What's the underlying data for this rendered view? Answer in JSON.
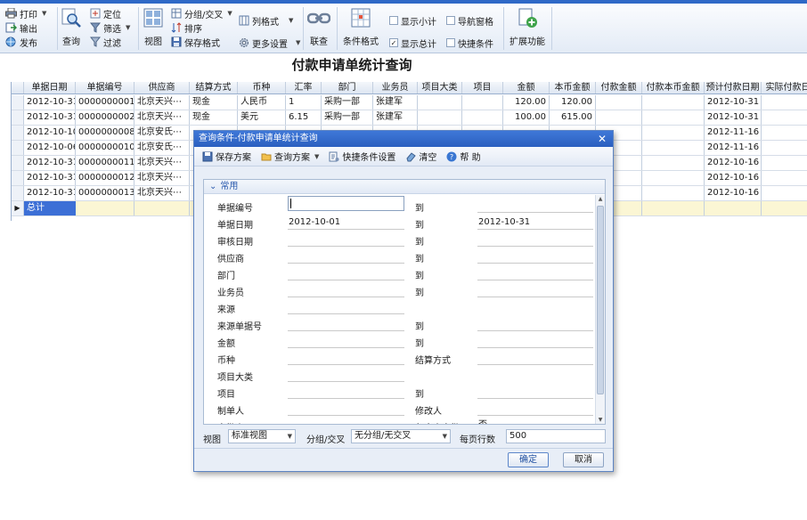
{
  "toolbar": {
    "print": "打印",
    "export": "输出",
    "publish": "发布",
    "query": "查询",
    "locate": "定位",
    "sift": "筛选",
    "filter": "过滤",
    "view": "视图",
    "group_cross": "分组/交叉",
    "sort": "排序",
    "save_format": "保存格式",
    "column_format": "列格式",
    "more_settings": "更多设置",
    "join_query": "联查",
    "condition_format": "条件格式",
    "show_subtotal": "显示小计",
    "show_total": "显示总计",
    "nav_pane": "导航窗格",
    "quick_condition": "快捷条件",
    "extend": "扩展功能"
  },
  "report_title": "付款申请单统计查询",
  "grid": {
    "columns": [
      "单据日期",
      "单据编号",
      "供应商",
      "结算方式",
      "币种",
      "汇率",
      "部门",
      "业务员",
      "项目大类",
      "项目",
      "金额",
      "本币金额",
      "付款金额",
      "付款本币金额",
      "预计付款日期",
      "实际付款日"
    ],
    "rows": [
      [
        "2012-10-31",
        "0000000001",
        "北京天兴⋯",
        "现金",
        "人民币",
        "1",
        "采购一部",
        "张建军",
        "",
        "",
        "120.00",
        "120.00",
        "",
        "",
        "2012-10-31",
        ""
      ],
      [
        "2012-10-31",
        "0000000002",
        "北京天兴⋯",
        "现金",
        "美元",
        "6.15",
        "采购一部",
        "张建军",
        "",
        "",
        "100.00",
        "615.00",
        "",
        "",
        "2012-10-31",
        ""
      ],
      [
        "2012-10-10",
        "0000000008",
        "北京安氏⋯",
        "",
        "",
        "",
        "",
        "",
        "",
        "",
        "",
        "",
        "",
        "",
        "2012-11-16",
        ""
      ],
      [
        "2012-10-06",
        "0000000010",
        "北京安氏⋯",
        "",
        "",
        "",
        "",
        "",
        "",
        "",
        "",
        "",
        "",
        "",
        "2012-11-16",
        ""
      ],
      [
        "2012-10-31",
        "0000000011",
        "北京天兴⋯",
        "",
        "",
        "",
        "",
        "",
        "",
        "",
        "",
        "",
        "",
        "",
        "2012-10-16",
        ""
      ],
      [
        "2012-10-31",
        "0000000012",
        "北京天兴⋯",
        "",
        "",
        "",
        "",
        "",
        "",
        "",
        "",
        "",
        "",
        "",
        "2012-10-16",
        ""
      ],
      [
        "2012-10-31",
        "0000000013",
        "北京天兴⋯",
        "",
        "",
        "",
        "",
        "",
        "",
        "",
        "",
        "",
        "",
        "",
        "2012-10-16",
        ""
      ]
    ],
    "total_label": "总计"
  },
  "dialog": {
    "title": "查询条件-付款申请单统计查询",
    "close": "✕",
    "toolbar": {
      "save_scheme": "保存方案",
      "query_scheme": "查询方案",
      "quick_setting": "快捷条件设置",
      "clear": "清空",
      "help": "帮 助"
    },
    "section": "常用",
    "to_label": "到",
    "fields": [
      {
        "label": "单据编号",
        "from": "",
        "to": "",
        "has_to": true
      },
      {
        "label": "单据日期",
        "from": "2012-10-01",
        "to": "2012-10-31",
        "has_to": true
      },
      {
        "label": "审核日期",
        "from": "",
        "to": "",
        "has_to": true
      },
      {
        "label": "供应商",
        "from": "",
        "to": "",
        "has_to": true
      },
      {
        "label": "部门",
        "from": "",
        "to": "",
        "has_to": true
      },
      {
        "label": "业务员",
        "from": "",
        "to": "",
        "has_to": true
      },
      {
        "label": "来源",
        "from": "",
        "to": "",
        "has_to": false
      },
      {
        "label": "来源单据号",
        "from": "",
        "to": "",
        "has_to": true
      },
      {
        "label": "金额",
        "from": "",
        "to": "",
        "has_to": true
      },
      {
        "label": "币种",
        "from": "",
        "to": "",
        "has_to": false,
        "second_label": "结算方式"
      },
      {
        "label": "项目大类",
        "from": "",
        "to": "",
        "has_to": false
      },
      {
        "label": "项目",
        "from": "",
        "to": "",
        "has_to": true
      },
      {
        "label": "制单人",
        "from": "",
        "to": "",
        "has_to": false,
        "second_label": "修改人"
      },
      {
        "label": "审批人",
        "from": "",
        "to": "否",
        "has_to": false,
        "second_label": "包含未审批"
      }
    ],
    "bottom": {
      "view_label": "视图",
      "view_value": "标准视图",
      "group_label": "分组/交叉",
      "group_value": "无分组/无交叉",
      "rows_label": "每页行数",
      "rows_value": "500"
    },
    "ok": "确定",
    "cancel": "取消"
  },
  "colors": {
    "accent": "#2f69c7",
    "selected_cell": "#3c6fd6",
    "total_row": "#fbf6d4"
  }
}
